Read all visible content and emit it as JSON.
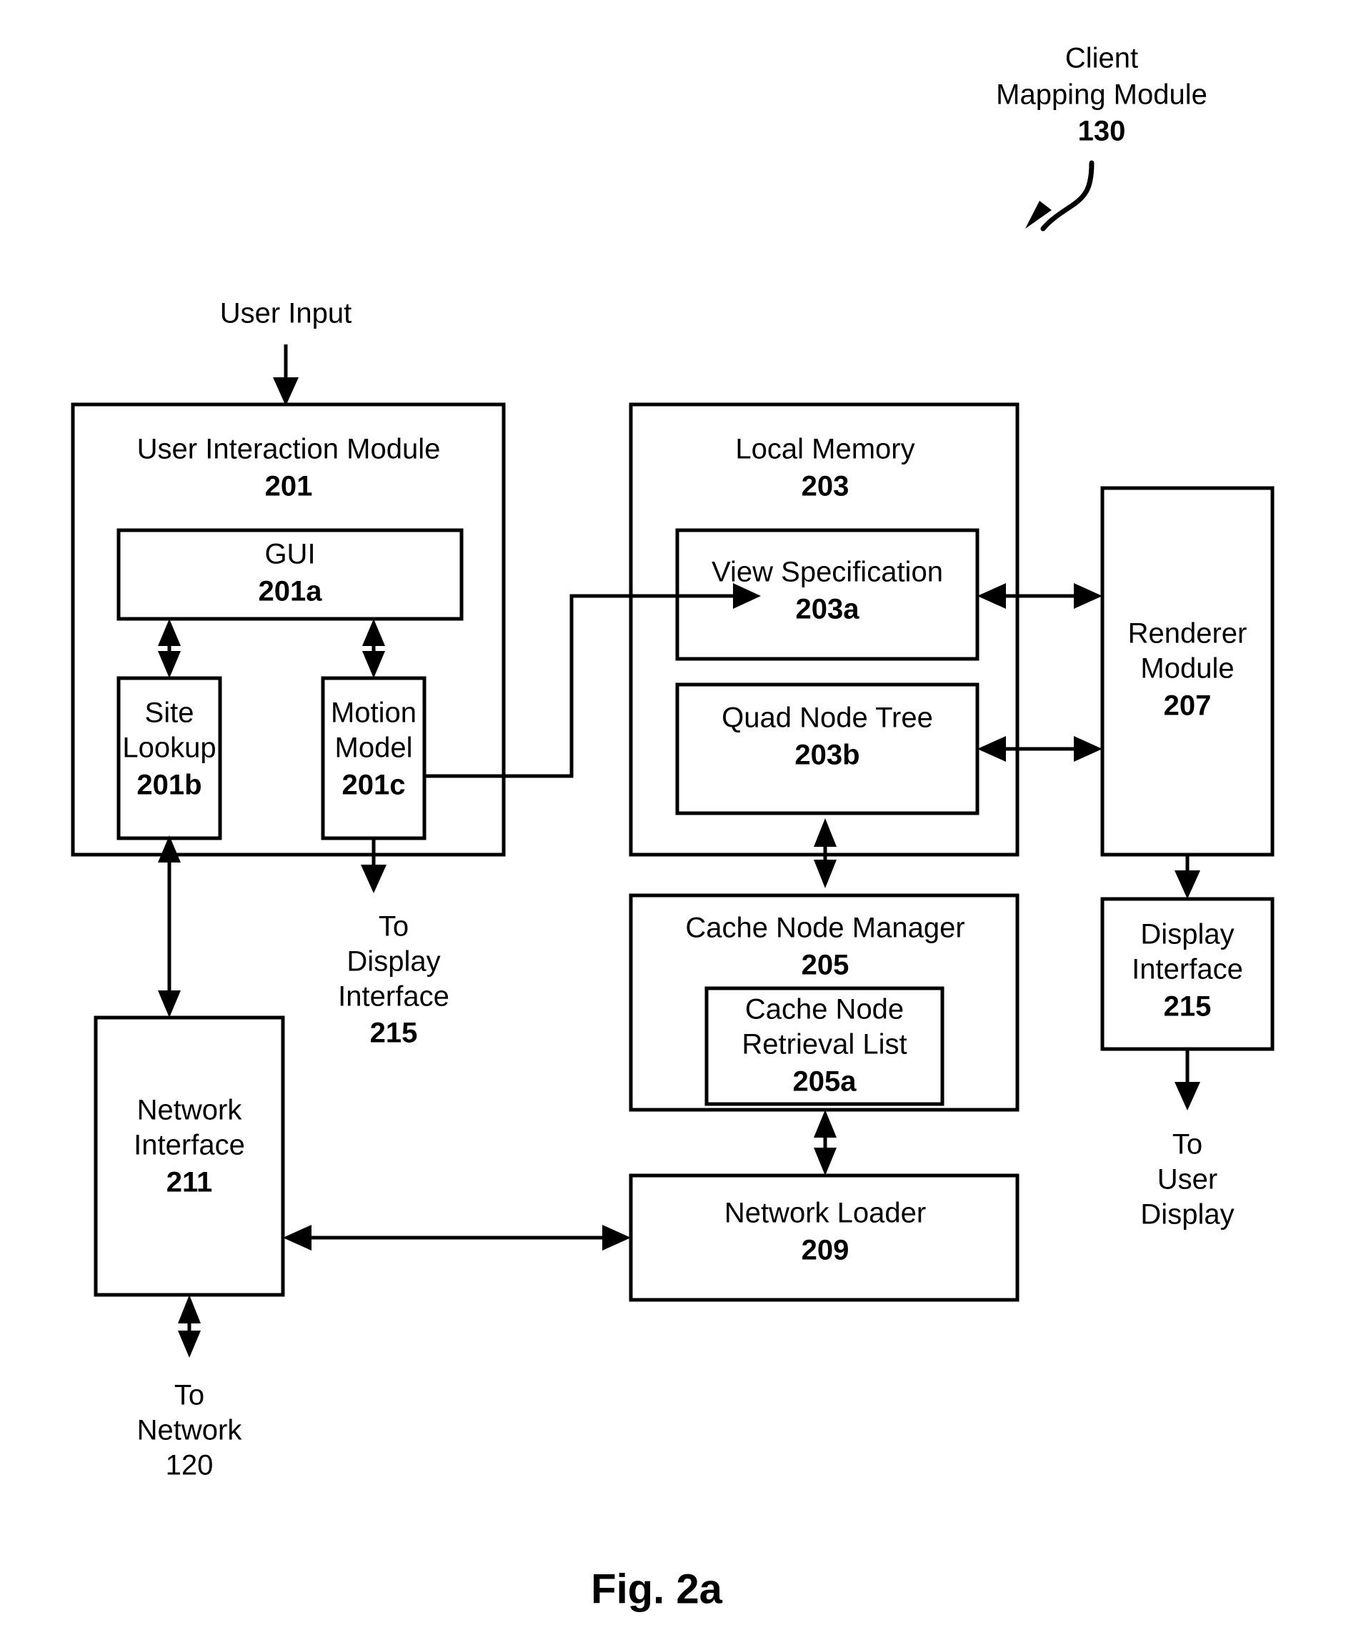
{
  "figure": {
    "caption": "Fig. 2a",
    "title_block": {
      "line1": "Client",
      "line2": "Mapping Module",
      "ref": "130"
    }
  },
  "inputs": {
    "user_input": "User Input"
  },
  "blocks": {
    "user_interaction_module": {
      "label": "User Interaction Module",
      "ref": "201"
    },
    "gui": {
      "label": "GUI",
      "ref": "201a"
    },
    "site_lookup": {
      "label_line1": "Site",
      "label_line2": "Lookup",
      "ref": "201b"
    },
    "motion_model": {
      "label_line1": "Motion",
      "label_line2": "Model",
      "ref": "201c"
    },
    "local_memory": {
      "label": "Local Memory",
      "ref": "203"
    },
    "view_specification": {
      "label": "View Specification",
      "ref": "203a"
    },
    "quad_node_tree": {
      "label": "Quad Node Tree",
      "ref": "203b"
    },
    "cache_node_manager": {
      "label": "Cache Node Manager",
      "ref": "205"
    },
    "cache_node_retrieval_list": {
      "label_line1": "Cache Node",
      "label_line2": "Retrieval List",
      "ref": "205a"
    },
    "network_loader": {
      "label": "Network Loader",
      "ref": "209"
    },
    "network_interface": {
      "label_line1": "Network",
      "label_line2": "Interface",
      "ref": "211"
    },
    "renderer_module": {
      "label_line1": "Renderer",
      "label_line2": "Module",
      "ref": "207"
    },
    "display_interface": {
      "label_line1": "Display",
      "label_line2": "Interface",
      "ref": "215"
    }
  },
  "callouts": {
    "to_display_interface": {
      "line1": "To",
      "line2": "Display",
      "line3": "Interface",
      "ref": "215"
    },
    "to_network": {
      "line1": "To",
      "line2": "Network",
      "ref": "120"
    },
    "to_user_display": {
      "line1": "To",
      "line2": "User",
      "line3": "Display"
    }
  },
  "colors": {
    "stroke": "#000000",
    "background": "#ffffff",
    "text": "#000000"
  }
}
